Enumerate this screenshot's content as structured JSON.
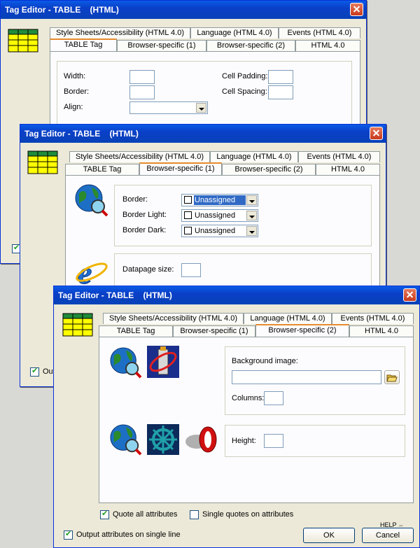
{
  "win1": {
    "title": "Tag Editor - TABLE    (HTML)",
    "tabs_top": [
      "Style Sheets/Accessibility (HTML 4.0)",
      "Language (HTML 4.0)",
      "Events (HTML 4.0)"
    ],
    "tabs_bottom": [
      "TABLE Tag",
      "Browser-specific (1)",
      "Browser-specific (2)",
      "HTML 4.0"
    ],
    "active_tab": "TABLE Tag",
    "width_label": "Width:",
    "border_label": "Border:",
    "align_label": "Align:",
    "cell_padding_label": "Cell Padding:",
    "cell_spacing_label": "Cell Spacing:"
  },
  "win2": {
    "title": "Tag Editor - TABLE    (HTML)",
    "tabs_top": [
      "Style Sheets/Accessibility (HTML 4.0)",
      "Language (HTML 4.0)",
      "Events (HTML 4.0)"
    ],
    "tabs_bottom": [
      "TABLE Tag",
      "Browser-specific (1)",
      "Browser-specific (2)",
      "HTML 4.0"
    ],
    "active_tab": "Browser-specific (1)",
    "border_label": "Border:",
    "border_value": "Unassigned",
    "border_light_label": "Border Light:",
    "border_light_value": "Unassigned",
    "border_dark_label": "Border Dark:",
    "border_dark_value": "Unassigned",
    "datapage_label": "Datapage size:"
  },
  "win3": {
    "title": "Tag Editor - TABLE    (HTML)",
    "tabs_top": [
      "Style Sheets/Accessibility (HTML 4.0)",
      "Language (HTML 4.0)",
      "Events (HTML 4.0)"
    ],
    "tabs_bottom": [
      "TABLE Tag",
      "Browser-specific (1)",
      "Browser-specific (2)",
      "HTML 4.0"
    ],
    "active_tab": "Browser-specific (2)",
    "background_image_label": "Background image:",
    "background_image_value": "",
    "columns_label": "Columns:",
    "height_label": "Height:",
    "quote_all_label": "Quote all attributes",
    "single_quotes_label": "Single quotes on attributes",
    "output_single_line_label": "Output attributes on single line",
    "help_label": "HELP",
    "ok_label": "OK",
    "cancel_label": "Cancel"
  },
  "behind": {
    "output_label_fragment": "Out"
  },
  "colors": {
    "title_blue": "#0a48d0",
    "dialog_bg": "#ece9d8",
    "selection": "#316ac5"
  }
}
